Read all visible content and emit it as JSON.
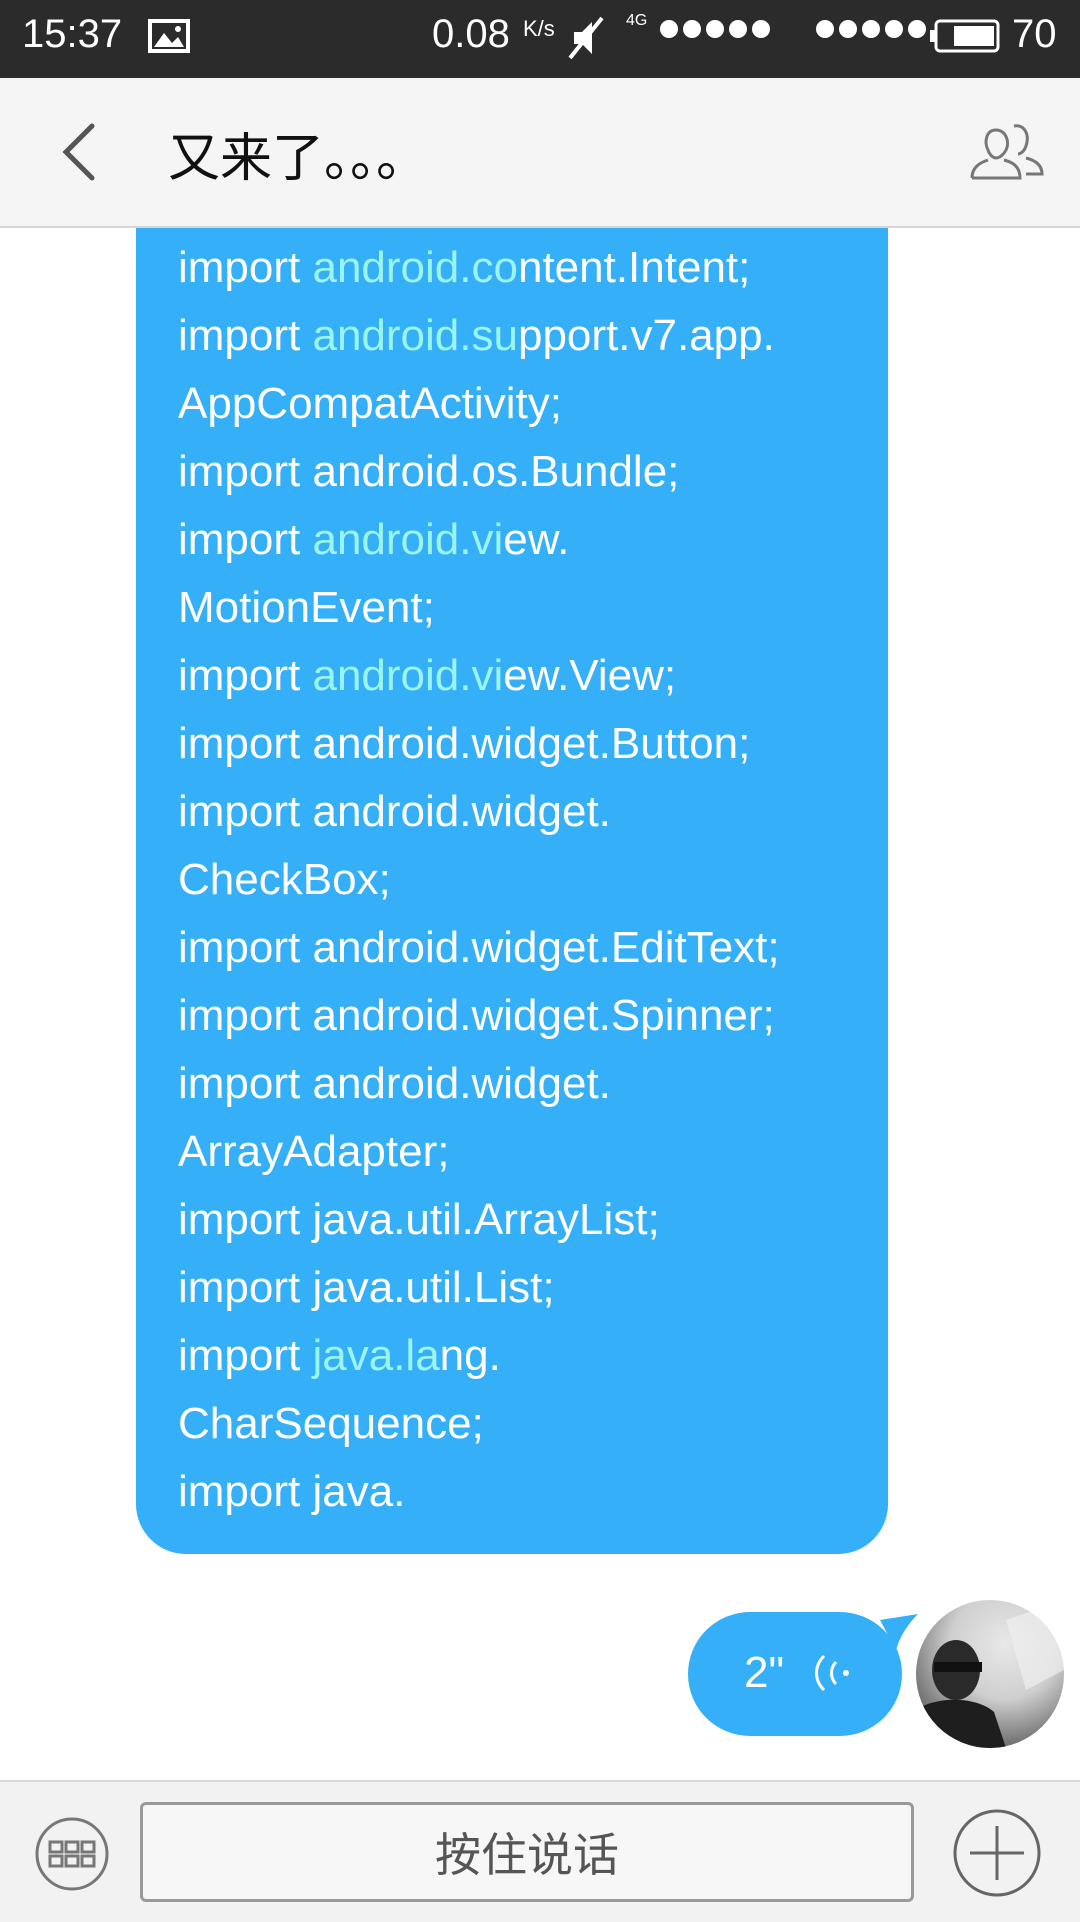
{
  "status_bar": {
    "time": "15:37",
    "network_speed": "0.08",
    "speed_unit": "K/s",
    "network_type": "4G",
    "battery": "70",
    "icons": [
      "image-icon",
      "mute-icon",
      "signal-dots-icon",
      "battery-icon"
    ]
  },
  "header": {
    "title": "又来了。。。",
    "back_icon": "chevron-left-icon",
    "members_icon": "group-icon"
  },
  "messages": {
    "code_lines": [
      {
        "pre": "import ",
        "hl": "android.co",
        "post": "ntent.Intent;"
      },
      {
        "pre": "import ",
        "hl": "android.su",
        "post": "pport.v7.app."
      },
      {
        "pre": "AppCompatActivity;",
        "hl": "",
        "post": ""
      },
      {
        "pre": "import android.os.Bundle;",
        "hl": "",
        "post": ""
      },
      {
        "pre": "import ",
        "hl": "android.vi",
        "post": "ew."
      },
      {
        "pre": "MotionEvent;",
        "hl": "",
        "post": ""
      },
      {
        "pre": "import ",
        "hl": "android.vi",
        "post": "ew.View;"
      },
      {
        "pre": "import android.widget.Button;",
        "hl": "",
        "post": ""
      },
      {
        "pre": "import android.widget.",
        "hl": "",
        "post": ""
      },
      {
        "pre": "CheckBox;",
        "hl": "",
        "post": ""
      },
      {
        "pre": "import android.widget.EditText;",
        "hl": "",
        "post": ""
      },
      {
        "pre": "import android.widget.Spinner;",
        "hl": "",
        "post": ""
      },
      {
        "pre": "import android.widget.",
        "hl": "",
        "post": ""
      },
      {
        "pre": "ArrayAdapter;",
        "hl": "",
        "post": ""
      },
      {
        "pre": "import java.util.ArrayList;",
        "hl": "",
        "post": ""
      },
      {
        "pre": "import java.util.List;",
        "hl": "",
        "post": ""
      },
      {
        "pre": "import ",
        "hl": "java.la",
        "post": "ng."
      },
      {
        "pre": "CharSequence;",
        "hl": "",
        "post": ""
      },
      {
        "pre": "import java.",
        "hl": "",
        "post": ""
      }
    ],
    "voice": {
      "duration": "2\"",
      "icon": "voice-wave-icon"
    }
  },
  "input_bar": {
    "hold_to_talk_label": "按住说话",
    "keyboard_icon": "keyboard-icon",
    "plus_icon": "plus-icon"
  },
  "colors": {
    "bubble": "#36aff9",
    "highlight": "#9af5ee",
    "status_bar": "#2b2b2b",
    "header_bg": "#f5f5f5"
  }
}
